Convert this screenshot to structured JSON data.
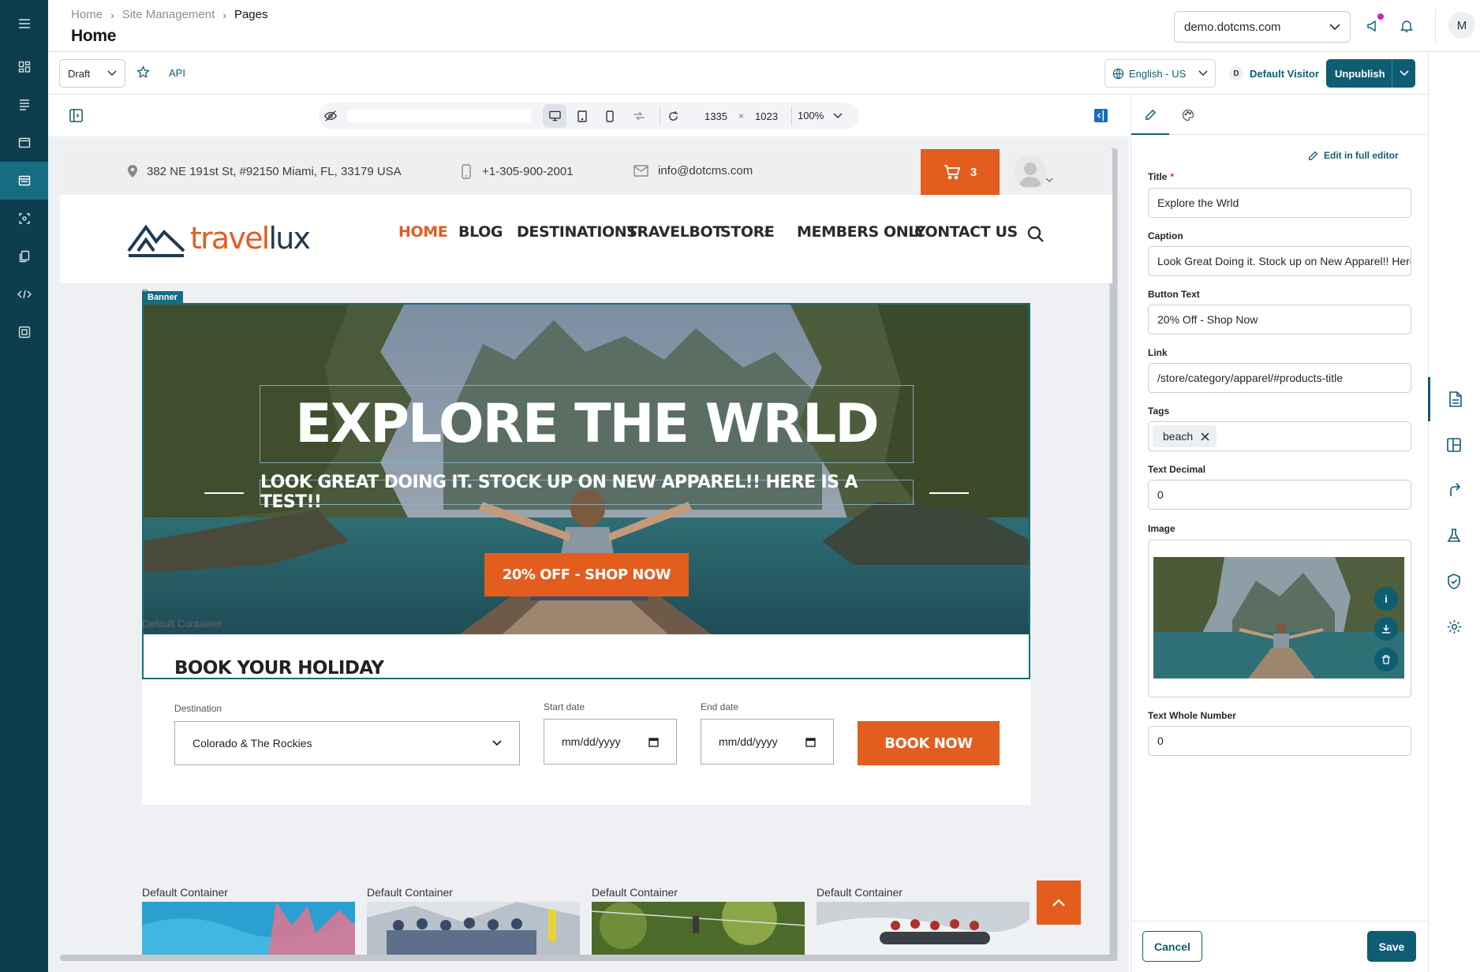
{
  "breadcrumb": {
    "items": [
      "Home",
      "Site Management",
      "Pages"
    ]
  },
  "page": {
    "title": "Home"
  },
  "site_selector": {
    "value": "demo.dotcms.com"
  },
  "user": {
    "initial": "M"
  },
  "toolbar": {
    "status_value": "Draft",
    "api_label": "API",
    "language_value": "English - US",
    "visitor_badge": "D",
    "visitor_label": "Default Visitor",
    "unpublish_label": "Unpublish"
  },
  "device_bar": {
    "width": "1335",
    "times": "×",
    "height": "1023",
    "zoom": "100%"
  },
  "preview": {
    "address": "382 NE 191st St, #92150 Miami, FL, 33179 USA",
    "phone": "+1-305-900-2001",
    "email": "info@dotcms.com",
    "cart_count": "3",
    "logo_left": "travel",
    "logo_right": "lux",
    "nav": [
      "HOME",
      "BLOG",
      "DESTINATIONS",
      "TRAVELBOT",
      "STORE",
      "MEMBERS ONLY",
      "CONTACT US"
    ],
    "banner_label": "Banner",
    "banner_ghost": "Banner",
    "hero_title": "EXPLORE THE WRLD",
    "hero_caption": "LOOK GREAT DOING IT. STOCK UP ON NEW APPAREL!! HERE IS A TEST!!",
    "hero_button": "20% OFF - SHOP NOW",
    "container_ghost": "Default Container",
    "booking": {
      "title": "BOOK YOUR HOLIDAY",
      "destination_label": "Destination",
      "destination_value": "Colorado & The Rockies",
      "start_label": "Start date",
      "end_label": "End date",
      "date_placeholder": "mm/dd/yyyy",
      "button": "BOOK NOW"
    },
    "tiles": [
      "Default Container",
      "Default Container",
      "Default Container",
      "Default Container"
    ]
  },
  "panel": {
    "edit_full_label": "Edit in full editor",
    "fields": {
      "title_label": "Title",
      "title_value": "Explore the Wrld",
      "caption_label": "Caption",
      "caption_value": "Look Great Doing it. Stock up on New Apparel!! Here is a test!!",
      "button_text_label": "Button Text",
      "button_text_value": "20% Off - Shop Now",
      "link_label": "Link",
      "link_value": "/store/category/apparel/#products-title",
      "tags_label": "Tags",
      "tag_value": "beach",
      "decimal_label": "Text Decimal",
      "decimal_value": "0",
      "image_label": "Image",
      "whole_label": "Text Whole Number",
      "whole_value": "0"
    },
    "image_actions": {
      "info": "i"
    },
    "cancel_label": "Cancel",
    "save_label": "Save"
  },
  "colors": {
    "nav_bg": "#0e3d4d",
    "primary": "#0e5d72",
    "accent": "#e35d1f",
    "highlight": "#166d82"
  },
  "icons": [
    "menu-icon",
    "dashboard-icon",
    "content-icon",
    "browser-icon",
    "pages-icon",
    "experiments-icon",
    "copy-icon",
    "code-icon",
    "apps-icon",
    "bell-icon",
    "megaphone-icon",
    "star-icon",
    "globe-icon",
    "cart-icon",
    "search-icon",
    "pencil-icon",
    "palette-icon",
    "document-icon",
    "layout-icon",
    "flow-icon",
    "flask-icon",
    "shield-icon",
    "gear-icon"
  ]
}
